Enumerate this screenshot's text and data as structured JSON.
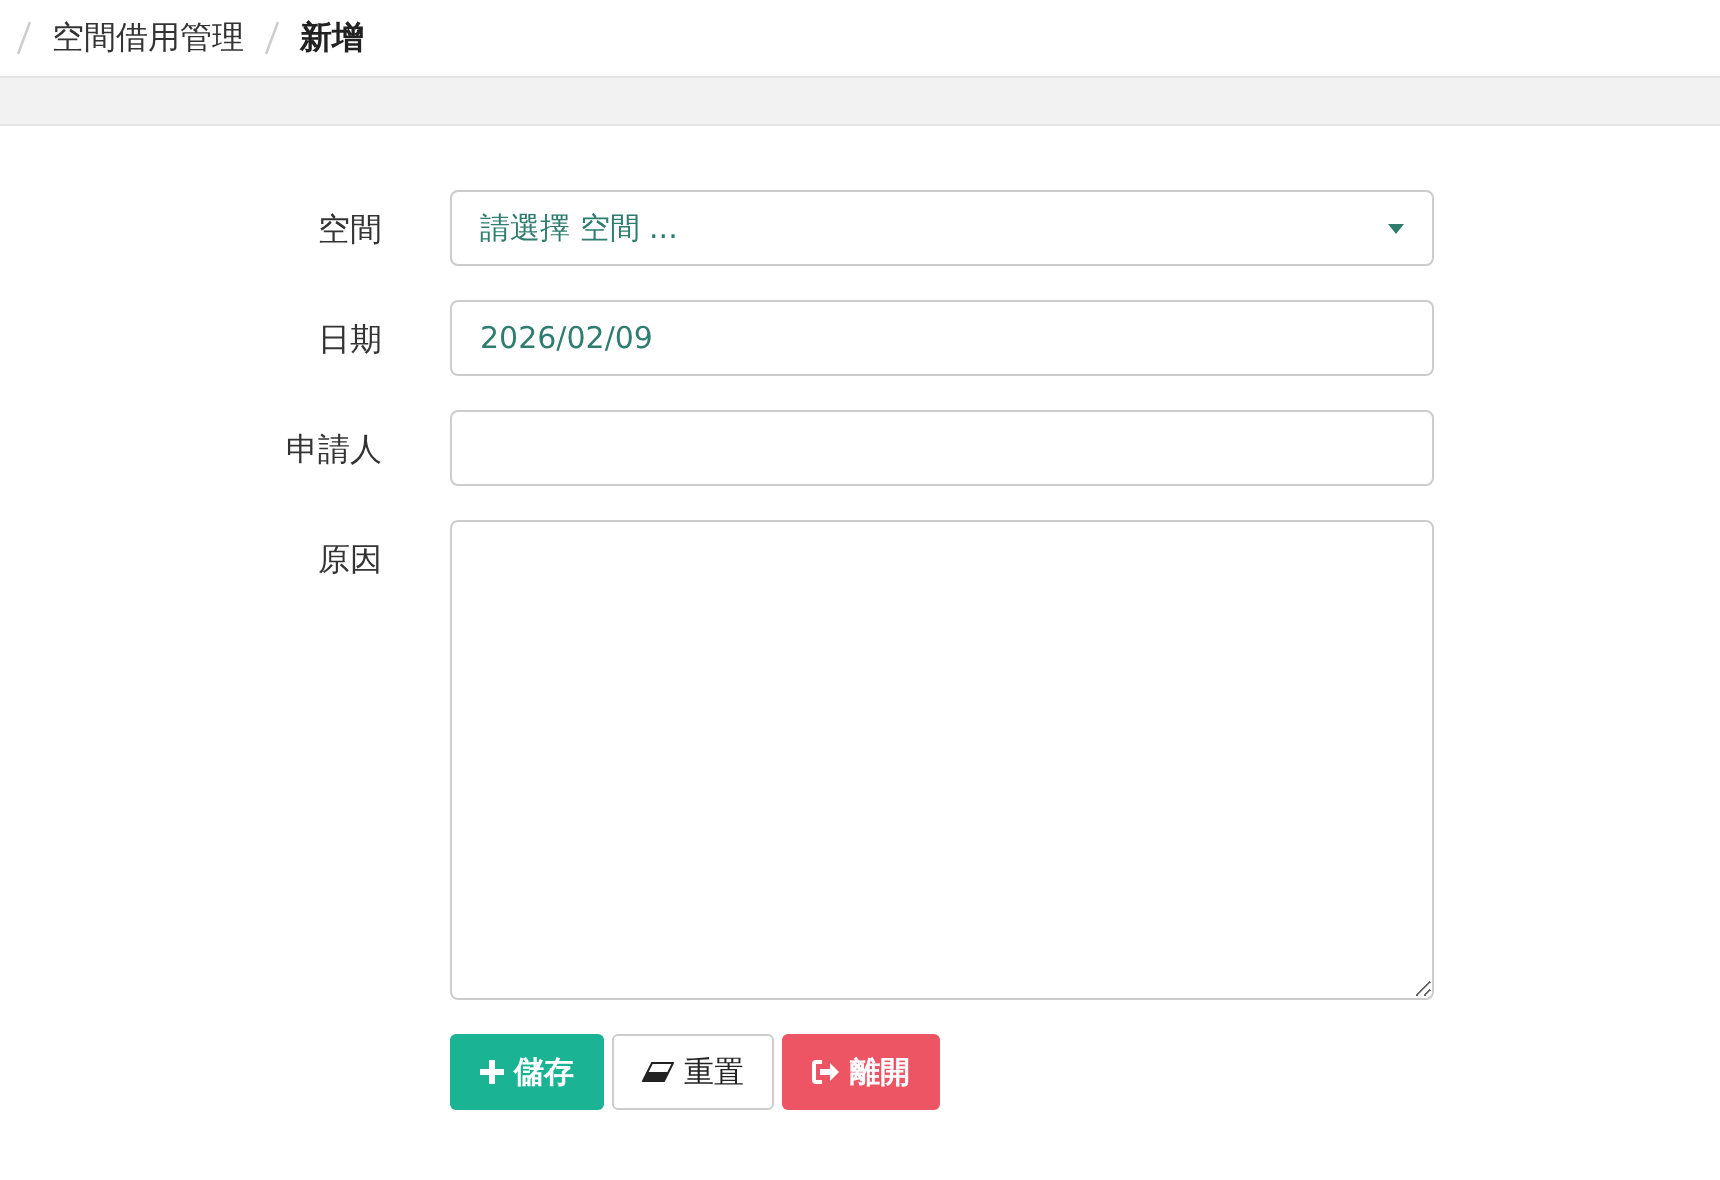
{
  "breadcrumb": [
    {
      "label": "空間借用管理",
      "active": false
    },
    {
      "label": "新增",
      "active": true
    }
  ],
  "fields": [
    {
      "label": "空間",
      "kind": "select",
      "placeholder": "請選擇 空間 ..."
    },
    {
      "label": "日期",
      "kind": "input",
      "value": "2026/02/09"
    },
    {
      "label": "申請人",
      "kind": "input"
    },
    {
      "label": "原因",
      "kind": "textarea"
    }
  ],
  "buttons": [
    {
      "label": "儲存",
      "kind": "save"
    },
    {
      "label": "重置",
      "kind": "reset"
    },
    {
      "label": "離開",
      "kind": "exit"
    }
  ]
}
